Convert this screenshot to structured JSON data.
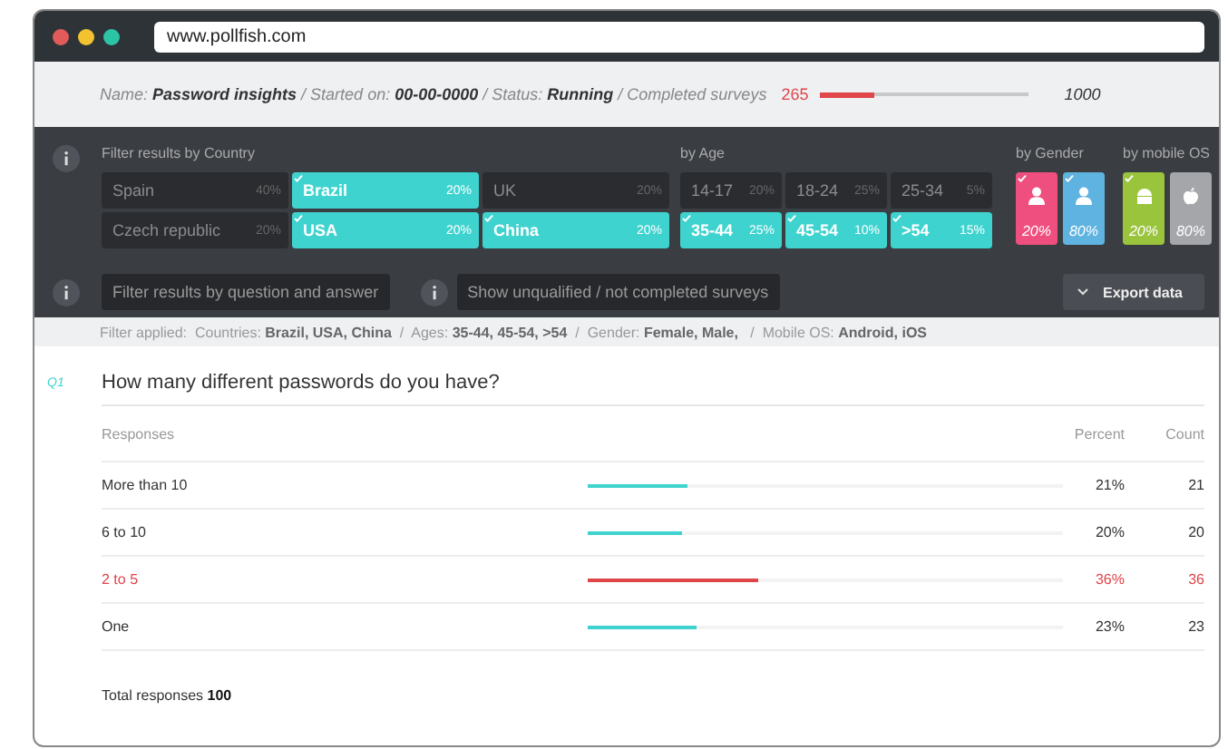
{
  "browser": {
    "url": "www.pollfish.com"
  },
  "survey_info": {
    "text": "Name: **Password insights** / Started on: **00-00-0000** / Status: **Running** / Completed surveys",
    "completed": "265",
    "progress": {
      "level": 0.265
    },
    "target": "1000"
  },
  "filters": {
    "country": {
      "label": "Filter results by Country",
      "items": [
        {
          "name": "Spain",
          "percent": "40%",
          "selected": false
        },
        {
          "name": "Brazil",
          "percent": "20%",
          "selected": true
        },
        {
          "name": "UK",
          "percent": "20%",
          "selected": false
        },
        {
          "name": "Czech republic",
          "percent": "20%",
          "selected": false
        },
        {
          "name": "USA",
          "percent": "20%",
          "selected": true
        },
        {
          "name": "China",
          "percent": "20%",
          "selected": true
        }
      ]
    },
    "age": {
      "label": "by Age",
      "items": [
        {
          "name": "14-17",
          "percent": "20%",
          "selected": false
        },
        {
          "name": "18-24",
          "percent": "25%",
          "selected": false
        },
        {
          "name": "25-34",
          "percent": "5%",
          "selected": false
        },
        {
          "name": "35-44",
          "percent": "25%",
          "selected": true
        },
        {
          "name": "45-54",
          "percent": "10%",
          "selected": true
        },
        {
          "name": ">54",
          "percent": "15%",
          "selected": true
        }
      ]
    },
    "gender": {
      "label": "by Gender",
      "items": [
        {
          "kind": "person",
          "percent": "20%",
          "selected": true,
          "color": "#ef4f7f"
        },
        {
          "kind": "person",
          "percent": "80%",
          "selected": true,
          "color": "#5fb3e0"
        }
      ]
    },
    "mobile_os": {
      "label": "by mobile OS",
      "items": [
        {
          "kind": "android",
          "percent": "20%",
          "selected": true,
          "color": "#9ac43c"
        },
        {
          "kind": "apple",
          "percent": "80%",
          "selected": false,
          "color": "#a4a6aa"
        }
      ]
    },
    "question_filter": "Filter results by question and answer",
    "unqualified_filter": "Show unqualified / not completed surveys",
    "export_button": "Export data"
  },
  "filter_applied": "Filter applied:  Countries: **Brazil, USA, China**  /  Ages: **35-44, 45-54, >54**  /  Gender: **Female, Male,**   /  Mobile OS: **Android, iOS**",
  "question": {
    "number": "Q1",
    "text": "How many different passwords do you have?",
    "columns": [
      "Responses",
      "Percent",
      "Count"
    ],
    "rows": [
      {
        "label": "More than 10",
        "level": 0.21,
        "percent": "21%",
        "count": "21",
        "highlighted": false
      },
      {
        "label": "6 to 10",
        "level": 0.2,
        "percent": "20%",
        "count": "20",
        "highlighted": false
      },
      {
        "label": "2 to 5",
        "level": 0.36,
        "percent": "36%",
        "count": "36",
        "highlighted": true
      },
      {
        "label": "One",
        "level": 0.23,
        "percent": "23%",
        "count": "23",
        "highlighted": false
      }
    ],
    "total": "Total responses **100**"
  }
}
